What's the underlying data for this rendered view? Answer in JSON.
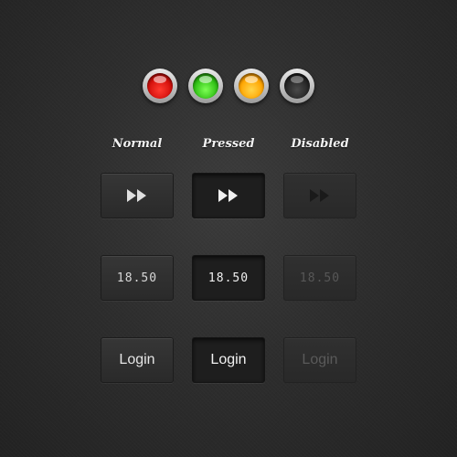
{
  "indicators": [
    {
      "name": "red-led",
      "color": "#e01410"
    },
    {
      "name": "green-led",
      "color": "#3cc01c"
    },
    {
      "name": "orange-led",
      "color": "#ffa800"
    },
    {
      "name": "off-led",
      "color": "#262626"
    }
  ],
  "columns": {
    "normal": "Normal",
    "pressed": "Pressed",
    "disabled": "Disabled"
  },
  "rows": {
    "fast_forward": {
      "icon": "fast-forward-icon"
    },
    "value": {
      "text": "18.50"
    },
    "login": {
      "label": "Login"
    }
  }
}
